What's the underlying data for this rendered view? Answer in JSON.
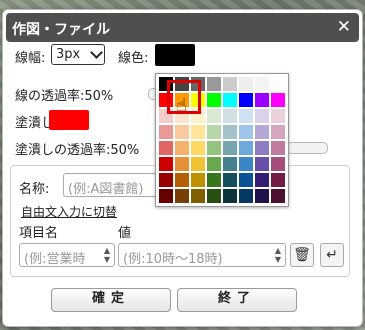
{
  "dialog": {
    "title": "作図・ファイル",
    "close_glyph": "✕"
  },
  "line_width": {
    "label": "線幅:",
    "value": "3px"
  },
  "line_color": {
    "label": "線色:",
    "color": "#000000"
  },
  "line_opacity": {
    "label": "線の透過率:50%"
  },
  "fill_color": {
    "label": "塗潰し色:",
    "color": "#ff0000"
  },
  "fill_opacity": {
    "label": "塗潰しの透過率:50%"
  },
  "name_field": {
    "label": "名称:",
    "placeholder": "(例:A図書館)"
  },
  "free_input_link": "自由文入力に切替",
  "attributes": {
    "key_header": "項目名",
    "value_header": "値",
    "key_placeholder": "(例:営業時",
    "value_placeholder": "(例:10時〜18時)"
  },
  "buttons": {
    "ok": "確定",
    "close": "終了"
  },
  "palette": {
    "rows": [
      [
        "#000000",
        "#444444",
        "#666666",
        "#999999",
        "#cccccc",
        "#eeeeee",
        "#f3f3f3",
        "#ffffff"
      ],
      [
        "#ff0000",
        "#ff9900",
        "#ffff00",
        "#00ff00",
        "#00ffff",
        "#0000ff",
        "#9900ff",
        "#ff00ff"
      ],
      [
        "#f4cccc",
        "#fce5cd",
        "#fff2cc",
        "#d9ead3",
        "#d0e0e3",
        "#cfe2f3",
        "#d9d2e9",
        "#ead1dc"
      ],
      [
        "#ea9999",
        "#f9cb9c",
        "#ffe599",
        "#b6d7a8",
        "#a2c4c9",
        "#9fc5e8",
        "#b4a7d6",
        "#d5a6bd"
      ],
      [
        "#e06666",
        "#f6b26b",
        "#ffd966",
        "#93c47d",
        "#76a5af",
        "#6fa8dc",
        "#8e7cc3",
        "#c27ba0"
      ],
      [
        "#cc0000",
        "#e69138",
        "#f1c232",
        "#6aa84f",
        "#45818e",
        "#3d85c6",
        "#674ea7",
        "#a64d79"
      ],
      [
        "#990000",
        "#b45f06",
        "#bf9000",
        "#38761d",
        "#134f5c",
        "#0b5394",
        "#351c75",
        "#741b47"
      ],
      [
        "#660000",
        "#783f04",
        "#7f6000",
        "#274e13",
        "#0c343d",
        "#073763",
        "#20124d",
        "#4c1130"
      ]
    ],
    "selected": "#ff0000"
  }
}
